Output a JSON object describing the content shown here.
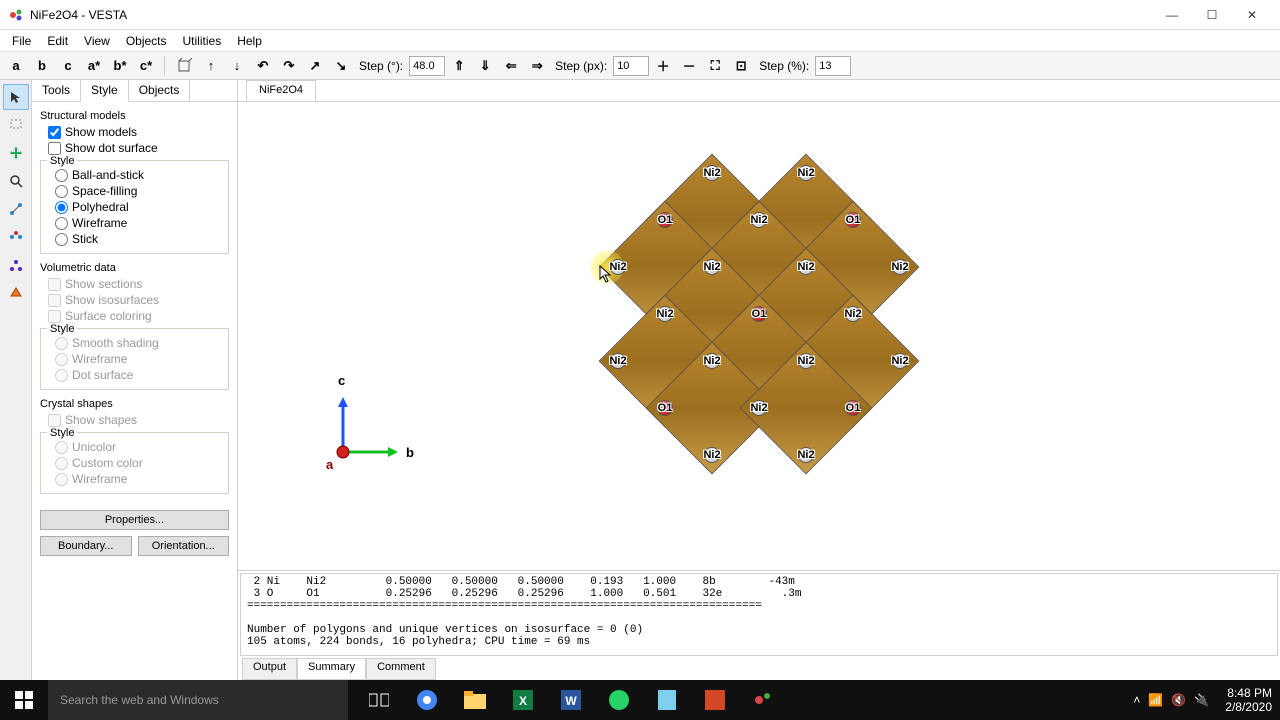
{
  "window": {
    "title": "NiFe2O4 - VESTA"
  },
  "menu": [
    "File",
    "Edit",
    "View",
    "Objects",
    "Utilities",
    "Help"
  ],
  "toolbar": {
    "axis_buttons": [
      "a",
      "b",
      "c",
      "a*",
      "b*",
      "c*"
    ],
    "step_deg_label": "Step (°):",
    "step_deg": "48.0",
    "step_px_label": "Step (px):",
    "step_px": "10",
    "step_pct_label": "Step (%):",
    "step_pct": "13"
  },
  "side_tabs": [
    "Tools",
    "Style",
    "Objects"
  ],
  "doc_tab": "NiFe2O4",
  "panel": {
    "structural_head": "Structural models",
    "show_models": "Show models",
    "show_dot": "Show dot surface",
    "style_head": "Style",
    "styles": [
      "Ball-and-stick",
      "Space-filling",
      "Polyhedral",
      "Wireframe",
      "Stick"
    ],
    "vol_head": "Volumetric data",
    "vol_items": [
      "Show sections",
      "Show isosurfaces",
      "Surface coloring"
    ],
    "vol_style": [
      "Smooth shading",
      "Wireframe",
      "Dot surface"
    ],
    "cryst_head": "Crystal shapes",
    "show_shapes": "Show shapes",
    "cryst_style": [
      "Unicolor",
      "Custom color",
      "Wireframe"
    ],
    "properties": "Properties...",
    "boundary": "Boundary...",
    "orientation": "Orientation..."
  },
  "axes": {
    "a": "a",
    "b": "b",
    "c": "c"
  },
  "atom_labels": {
    "ni": "Ni2",
    "o": "O1"
  },
  "output": {
    "text": " 2 Ni    Ni2         0.50000   0.50000   0.50000    0.193   1.000    8b        -43m\n 3 O     O1          0.25296   0.25296   0.25296    1.000   0.501    32e         .3m\n==============================================================================\n\nNumber of polygons and unique vertices on isosurface = 0 (0)\n105 atoms, 224 bonds, 16 polyhedra; CPU time = 69 ms",
    "tabs": [
      "Output",
      "Summary",
      "Comment"
    ]
  },
  "taskbar": {
    "search": "Search the web and Windows",
    "time": "8:48 PM",
    "date": "2/8/2020"
  }
}
